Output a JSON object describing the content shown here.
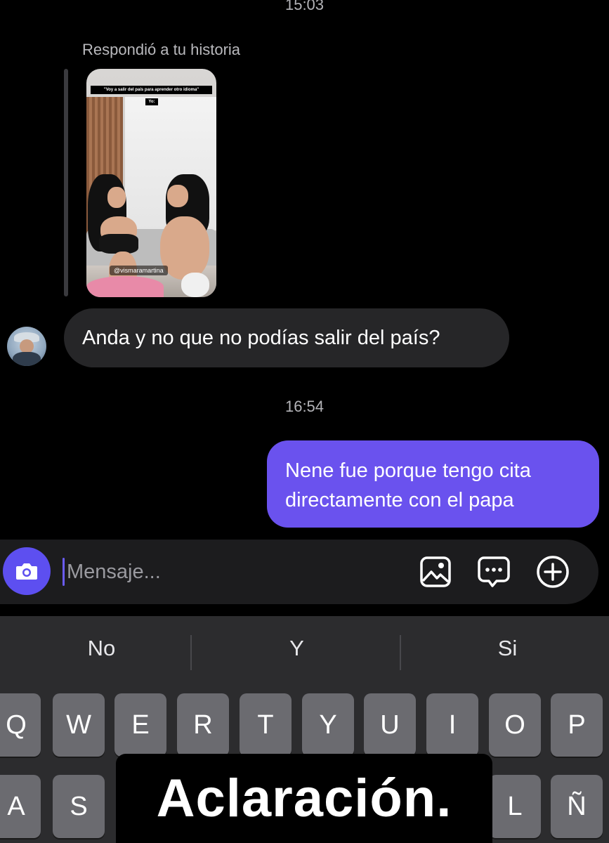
{
  "chat": {
    "timestamp_top": "15:03",
    "reply_label": "Respondió a tu historia",
    "story": {
      "caption": "\"Voy a salir del país para aprender otro idioma\"",
      "caption_tag": "Yo:",
      "handle": "@vismaramartina"
    },
    "incoming_message": "Anda y no que no podías salir del país?",
    "timestamp_mid": "16:54",
    "outgoing_message": "Nene fue porque tengo cita directamente con el papa"
  },
  "composer": {
    "placeholder": "Mensaje...",
    "icons": [
      "camera-icon",
      "gallery-icon",
      "sticker-icon",
      "plus-icon"
    ]
  },
  "keyboard": {
    "suggestions": [
      "No",
      "Y",
      "Si"
    ],
    "row1": [
      "Q",
      "W",
      "E",
      "R",
      "T",
      "Y",
      "U",
      "I",
      "O",
      "P"
    ],
    "row2": [
      "A",
      "S",
      "L",
      "Ñ"
    ]
  },
  "overlay": {
    "caption": "Aclaración."
  },
  "colors": {
    "outgoing_bubble": "#6a52ee",
    "incoming_bubble": "#262628",
    "camera_button": "#5d4ff0",
    "background": "#000000",
    "keyboard": "#2c2c2e",
    "key": "#6b6b70"
  }
}
